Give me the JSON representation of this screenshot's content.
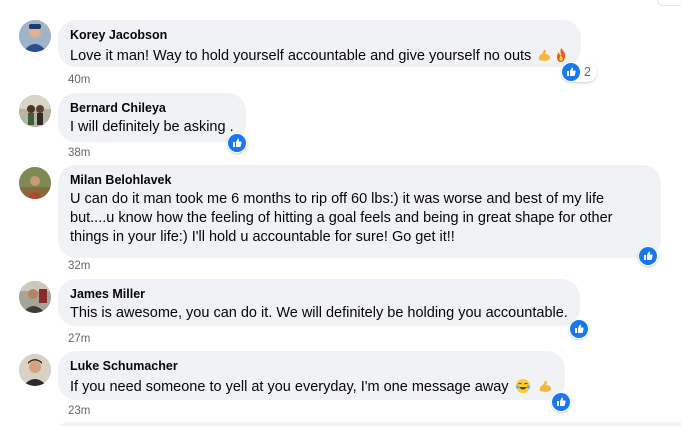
{
  "comments": [
    {
      "author": "Korey Jacobson",
      "text": "Love it man! Way to hold yourself accountable and give yourself no outs",
      "emojis": [
        "flexed-biceps",
        "fire"
      ],
      "time": "40m",
      "reaction_count": "2"
    },
    {
      "author": "Bernard Chileya",
      "text": "I will definitely be asking .",
      "time": "38m"
    },
    {
      "author": "Milan Belohlavek",
      "text": "U can do it man took me 6 months to rip off 60 lbs:) it was worse and best of my life\nbut....u know how the feeling of hitting a goal feels and being in great shape for other\nthings in your life:) I'll hold u accountable for sure! Go get it!!",
      "time": "32m"
    },
    {
      "author": "James Miller",
      "text": "This is awesome, you can do it. We will definitely be holding you accountable.",
      "time": "27m"
    },
    {
      "author": "Luke Schumacher",
      "text": "If you need someone to yell at you everyday, I'm one message away",
      "emojis": [
        "tears-of-joy",
        "flexed-biceps"
      ],
      "time": "23m"
    }
  ],
  "colors": {
    "bubble": "#f0f2f5",
    "like_blue": "#1877f2",
    "muted_text": "#65676b"
  }
}
